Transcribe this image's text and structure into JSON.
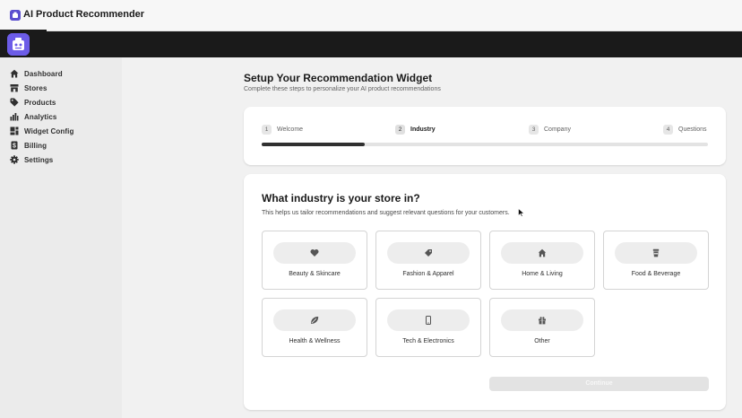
{
  "window": {
    "title": "AI Product Recommender"
  },
  "sidebar": {
    "items": [
      {
        "label": "Dashboard",
        "icon": "home-icon"
      },
      {
        "label": "Stores",
        "icon": "store-icon"
      },
      {
        "label": "Products",
        "icon": "tag-icon"
      },
      {
        "label": "Analytics",
        "icon": "bar-chart-icon"
      },
      {
        "label": "Widget Config",
        "icon": "layout-icon"
      },
      {
        "label": "Billing",
        "icon": "dollar-icon"
      },
      {
        "label": "Settings",
        "icon": "gear-icon"
      }
    ]
  },
  "page": {
    "title": "Setup Your Recommendation Widget",
    "subtitle": "Complete these steps to personalize your AI product recommendations"
  },
  "steps": {
    "items": [
      {
        "number": "1",
        "label": "Welcome"
      },
      {
        "number": "2",
        "label": "Industry"
      },
      {
        "number": "3",
        "label": "Company"
      },
      {
        "number": "4",
        "label": "Questions"
      }
    ],
    "active_index": 1,
    "progress": 0.23
  },
  "question": {
    "title": "What industry is your store in?",
    "description": "This helps us tailor recommendations and suggest relevant questions for your customers."
  },
  "options": [
    {
      "label": "Beauty & Skincare",
      "icon": "heart-icon"
    },
    {
      "label": "Fashion & Apparel",
      "icon": "tag-icon"
    },
    {
      "label": "Home & Living",
      "icon": "home-icon"
    },
    {
      "label": "Food & Beverage",
      "icon": "cup-icon"
    },
    {
      "label": "Health & Wellness",
      "icon": "leaf-icon"
    },
    {
      "label": "Tech & Electronics",
      "icon": "phone-icon"
    },
    {
      "label": "Other",
      "icon": "gift-icon"
    }
  ],
  "actions": {
    "continue_label": "Continue",
    "continue_disabled": true
  },
  "colors": {
    "topbar": "#1a1a1a",
    "brand": "#6c5ce7",
    "progress": "#303030",
    "disabled_button": "#e3e3e3"
  }
}
